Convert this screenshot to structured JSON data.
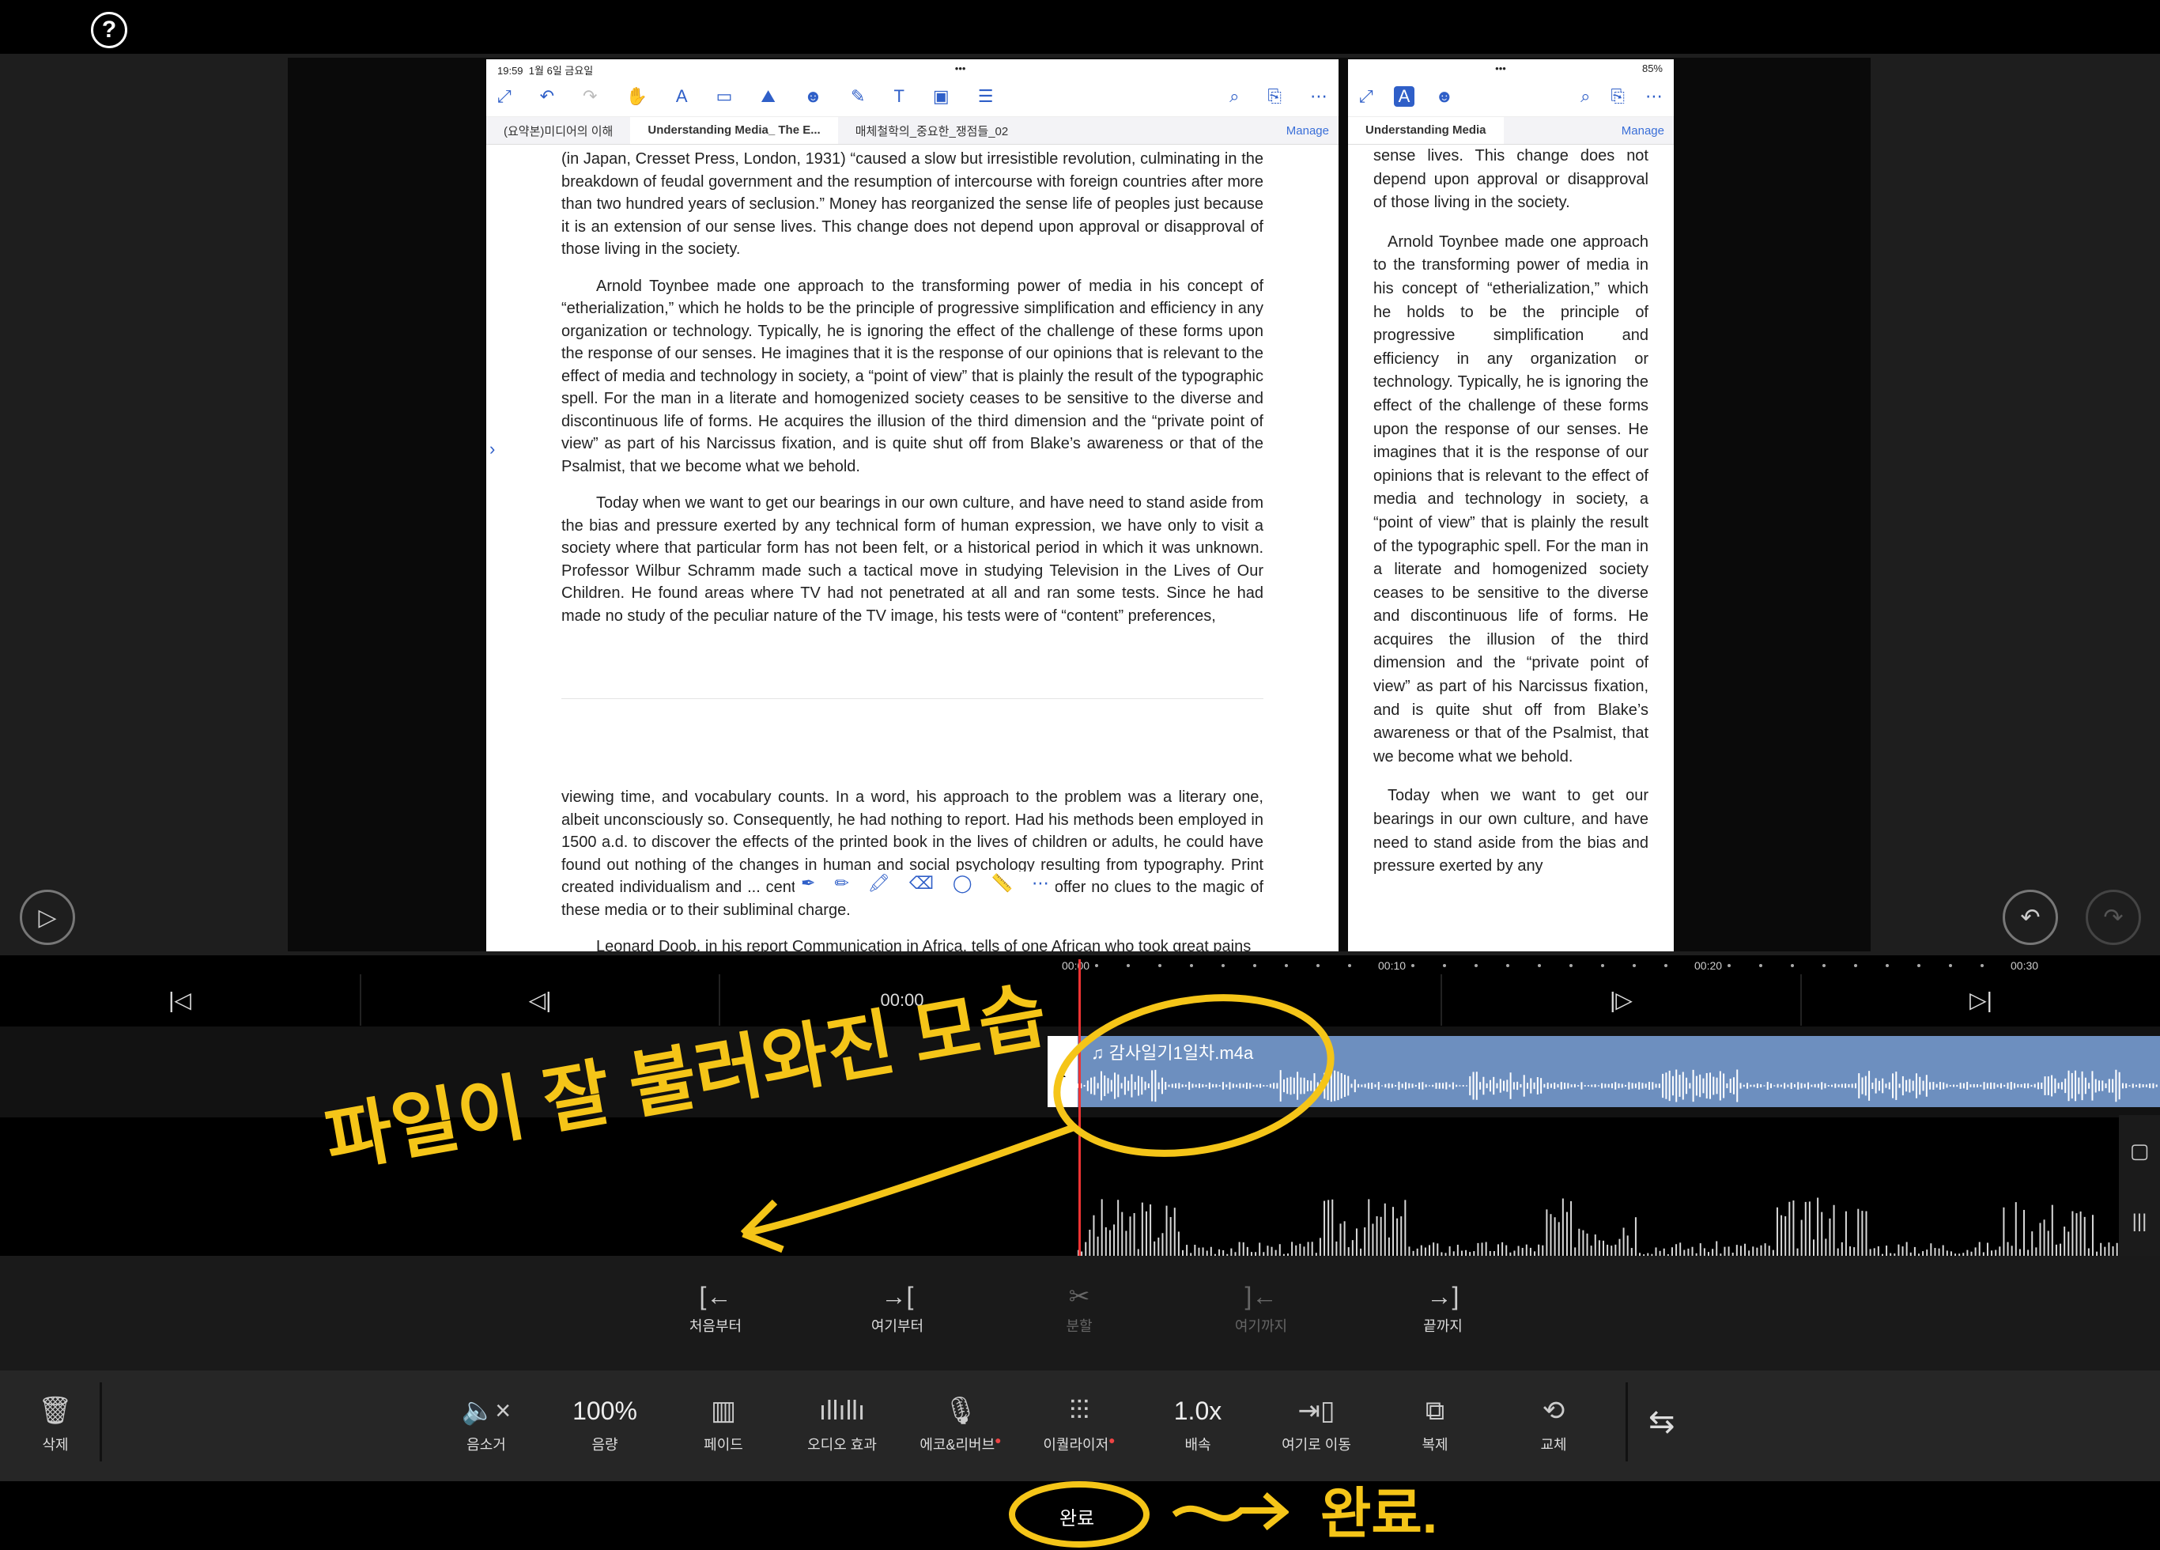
{
  "colors": {
    "accent": "#2f5fc8",
    "highlight": "#2a8a4a",
    "clip": "#6d8fbf",
    "playhead": "#e33",
    "annotation": "#f5c518"
  },
  "status": {
    "time": "19:59",
    "date": "1월 6일 금요일",
    "battery": "85%"
  },
  "left_tabs": [
    "(요약본)미디어의 이해",
    "Understanding Media_ The E...",
    "매체철학의_중요한_쟁점들_02"
  ],
  "right_tab": "Understanding Media",
  "manage": "Manage",
  "doc_left": {
    "p1": "(in Japan, Cresset Press, London, 1931) “caused a slow but irresistible revolution, culminating in the breakdown of feudal government and the resumption of intercourse with foreign countries after more than two hundred years of seclusion.” Money has reorganized the sense life of peoples just because it is an extension of our sense lives. This change does not depend upon approval or disapproval of those living in the society.",
    "p2": "Arnold Toynbee made one approach to the transforming power of media in his concept of “etherialization,” which he holds to be the principle of progressive simplification and efficiency in any organization or technology. Typically, he is ignoring the effect of the challenge of these forms upon the response of our senses. He imagines that it is the response of our opinions that is relevant to the effect of media and technology in society, a “point of view” that is plainly the result of the typographic spell. For the man in a literate and homogenized society ceases to be sensitive to the diverse and discontinuous life of forms. He acquires the illusion of the third dimension and the “private point of view” as part of his Narcissus fixation, and is quite shut off from Blake’s awareness or that of the Psalmist, that we become what we behold.",
    "p3": "Today when we want to get our bearings in our own culture, and have need to stand aside from the bias and pressure exerted by any technical form of human expression, we have only to visit a society where that particular form has not been felt, or a historical period in which it was unknown. Professor Wilbur Schramm made such a tactical move in studying Television in the Lives of Our Children. He found areas where TV had not penetrated at all and ran some tests. Since he had made no study of the peculiar nature of the TV image, his tests were of “content” preferences,",
    "p4": "viewing time, and vocabulary counts. In a word, his approach to the problem was a literary one, albeit unconsciously so. Consequently, he had nothing to report. Had his methods been employed in 1500 a.d. to discover the effects of the printed book in the lives of children or adults, he could have found out nothing of the changes in human and social psychology resulting from typography. Print created individualism and ... century. Program and “content” analysis offer no clues to the magic of these media or to their subliminal charge.",
    "p5": "Leonard Doob, in his report Communication in Africa, tells of one African who took great pains"
  },
  "doc_right": {
    "p1": "sense lives. This change does not depend upon approval or disapproval of those living in the society.",
    "p2": "Arnold Toynbee made one approach to the transforming power of media in his concept of “etherialization,” which he holds to be the principle of progressive simplification and efficiency in any organization or technology. Typically, he is ignoring the effect of the challenge of these forms upon the response of our senses. He imagines that it is the response of our opinions that is relevant to the effect of media and technology in society, a “point of view” that is plainly the result of the typographic spell. For the man in a literate and homogenized society ceases to be sensitive to the diverse and discontinuous life of forms. He acquires the illusion of the third dimension and the “private point of view” as part of his Narcissus fixation, and is quite shut off from Blake’s awareness or that of the Psalmist, that we become what we behold.",
    "p3": "Today when we want to get our bearings in our own culture, and have need to stand aside from the bias and pressure exerted by any"
  },
  "timeline": {
    "current": "00:00",
    "ticks": [
      "00:00",
      "00:10",
      "00:20",
      "00:30"
    ]
  },
  "clip": {
    "name": "감사일기1일차.m4a"
  },
  "edit_tools": [
    {
      "label": "처음부터",
      "icon": "trim-start-icon",
      "glyph": "[←"
    },
    {
      "label": "여기부터",
      "icon": "trim-from-here-icon",
      "glyph": "→["
    },
    {
      "label": "분할",
      "icon": "split-icon",
      "glyph": "✂"
    },
    {
      "label": "여기까지",
      "icon": "trim-to-here-icon",
      "glyph": "]←"
    },
    {
      "label": "끝까지",
      "icon": "trim-end-icon",
      "glyph": "→]"
    }
  ],
  "bottom_tools": {
    "delete": "삭제",
    "mute": "음소거",
    "volume_value": "100%",
    "volume": "음량",
    "fade": "페이드",
    "audio_effect": "오디오 효과",
    "echo": "에코&리버브",
    "equalizer": "이퀄라이저",
    "speed_value": "1.0x",
    "speed": "배속",
    "move_here": "여기로 이동",
    "duplicate": "복제",
    "replace": "교체"
  },
  "done": "완료",
  "annotations": {
    "note1": "파일이 잘 불러와진 모습",
    "note2": "완료."
  }
}
